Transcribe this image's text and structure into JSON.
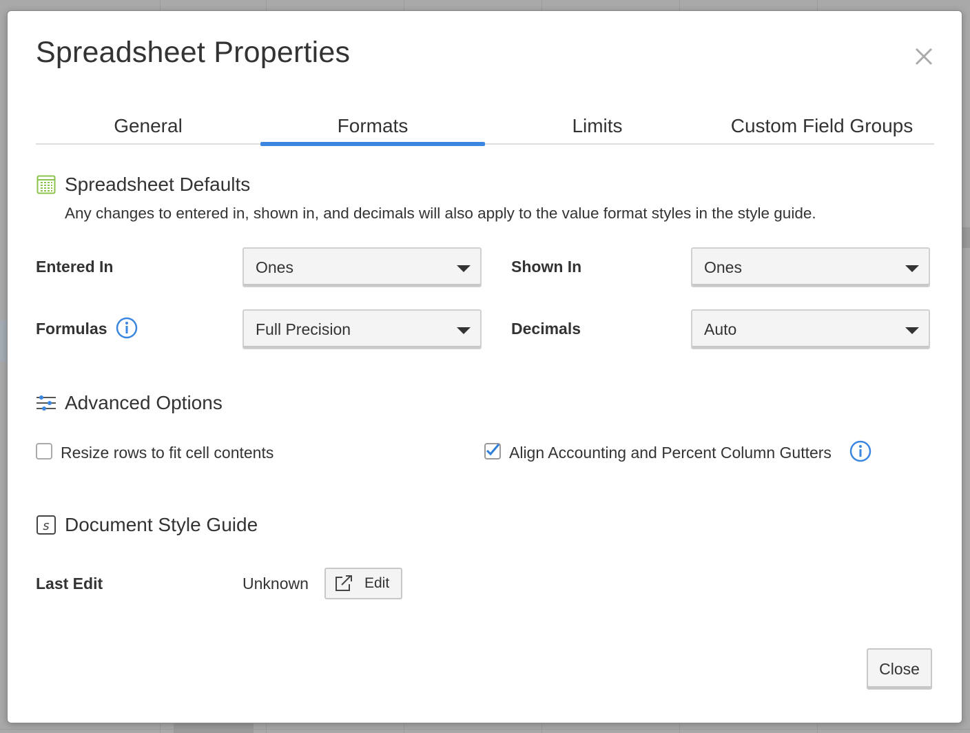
{
  "dialog": {
    "title": "Spreadsheet Properties",
    "close_icon": "close-icon"
  },
  "tabs": [
    {
      "label": "General",
      "active": false
    },
    {
      "label": "Formats",
      "active": true
    },
    {
      "label": "Limits",
      "active": false
    },
    {
      "label": "Custom Field Groups",
      "active": false
    }
  ],
  "spreadsheet_defaults": {
    "heading": "Spreadsheet Defaults",
    "icon": "spreadsheet-grid-icon",
    "note": "Any changes to entered in, shown in, and decimals will also apply to the value format styles in the style guide.",
    "entered_in": {
      "label": "Entered In",
      "value": "Ones"
    },
    "shown_in": {
      "label": "Shown In",
      "value": "Ones"
    },
    "formulas": {
      "label": "Formulas",
      "value": "Full Precision"
    },
    "decimals": {
      "label": "Decimals",
      "value": "Auto"
    }
  },
  "advanced_options": {
    "heading": "Advanced Options",
    "icon": "sliders-icon",
    "resize_rows": {
      "label": "Resize rows to fit cell contents",
      "checked": false
    },
    "align_gutters": {
      "label": "Align Accounting and Percent Column Gutters",
      "checked": true
    }
  },
  "style_guide": {
    "heading": "Document Style Guide",
    "icon": "style-guide-s-icon",
    "last_edit_label": "Last Edit",
    "last_edit_value": "Unknown",
    "edit_label": "Edit"
  },
  "footer": {
    "close_label": "Close"
  },
  "colors": {
    "accent": "#3b86e0",
    "spreadsheet_icon": "#8bc34a",
    "info": "#3b86e0"
  }
}
